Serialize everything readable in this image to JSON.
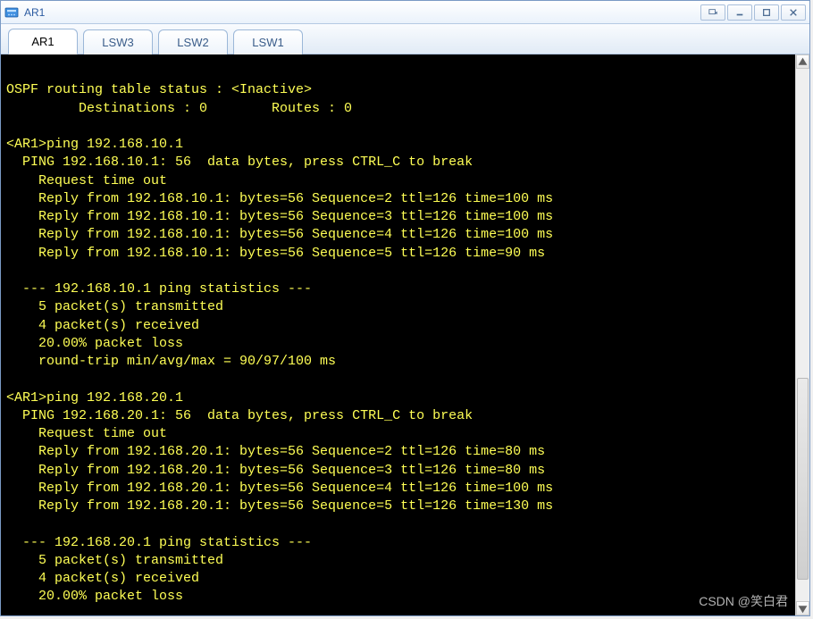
{
  "window": {
    "title": "AR1"
  },
  "tabs": [
    {
      "label": "AR1",
      "active": true
    },
    {
      "label": "LSW3",
      "active": false
    },
    {
      "label": "LSW2",
      "active": false
    },
    {
      "label": "LSW1",
      "active": false
    }
  ],
  "terminal": {
    "lines": [
      "",
      "OSPF routing table status : <Inactive>",
      "         Destinations : 0        Routes : 0",
      "",
      "<AR1>ping 192.168.10.1",
      "  PING 192.168.10.1: 56  data bytes, press CTRL_C to break",
      "    Request time out",
      "    Reply from 192.168.10.1: bytes=56 Sequence=2 ttl=126 time=100 ms",
      "    Reply from 192.168.10.1: bytes=56 Sequence=3 ttl=126 time=100 ms",
      "    Reply from 192.168.10.1: bytes=56 Sequence=4 ttl=126 time=100 ms",
      "    Reply from 192.168.10.1: bytes=56 Sequence=5 ttl=126 time=90 ms",
      "",
      "  --- 192.168.10.1 ping statistics ---",
      "    5 packet(s) transmitted",
      "    4 packet(s) received",
      "    20.00% packet loss",
      "    round-trip min/avg/max = 90/97/100 ms",
      "",
      "<AR1>ping 192.168.20.1",
      "  PING 192.168.20.1: 56  data bytes, press CTRL_C to break",
      "    Request time out",
      "    Reply from 192.168.20.1: bytes=56 Sequence=2 ttl=126 time=80 ms",
      "    Reply from 192.168.20.1: bytes=56 Sequence=3 ttl=126 time=80 ms",
      "    Reply from 192.168.20.1: bytes=56 Sequence=4 ttl=126 time=100 ms",
      "    Reply from 192.168.20.1: bytes=56 Sequence=5 ttl=126 time=130 ms",
      "",
      "  --- 192.168.20.1 ping statistics ---",
      "    5 packet(s) transmitted",
      "    4 packet(s) received",
      "    20.00% packet loss"
    ]
  },
  "watermark": "CSDN @笑白君"
}
